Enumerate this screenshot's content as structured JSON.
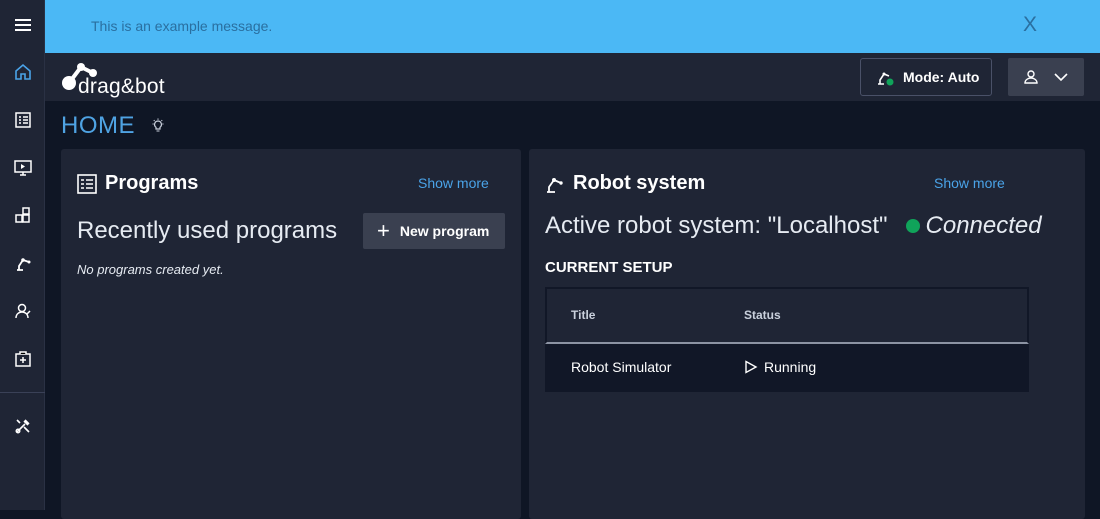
{
  "banner": {
    "message": "This is an example message.",
    "close_label": "X"
  },
  "sidebar": {
    "items": [
      {
        "name": "menu-icon"
      },
      {
        "name": "home-icon"
      },
      {
        "name": "programs-icon"
      },
      {
        "name": "monitor-icon"
      },
      {
        "name": "modules-icon"
      },
      {
        "name": "robot-arm-icon"
      },
      {
        "name": "user-settings-icon"
      },
      {
        "name": "add-medical-icon"
      },
      {
        "name": "tools-icon"
      }
    ]
  },
  "topbar": {
    "logo_text": "drag&bot",
    "mode_label": "Mode: Auto"
  },
  "page": {
    "title": "HOME"
  },
  "programs_card": {
    "title": "Programs",
    "show_more": "Show more",
    "recent_title": "Recently used programs",
    "new_program_label": "New program",
    "empty_message": "No programs created yet."
  },
  "robot_card": {
    "title": "Robot system",
    "show_more": "Show more",
    "active_text": "Active robot system: \"Localhost\"",
    "connection_status": "Connected",
    "setup_title": "CURRENT SETUP",
    "columns": [
      "Title",
      "Status"
    ],
    "rows": [
      {
        "title": "Robot Simulator",
        "status": "Running"
      }
    ]
  },
  "colors": {
    "accent": "#4aa3e8",
    "banner": "#4bb8f5",
    "connected": "#10a35a",
    "card": "#1f2535",
    "background": "#0f1625"
  }
}
